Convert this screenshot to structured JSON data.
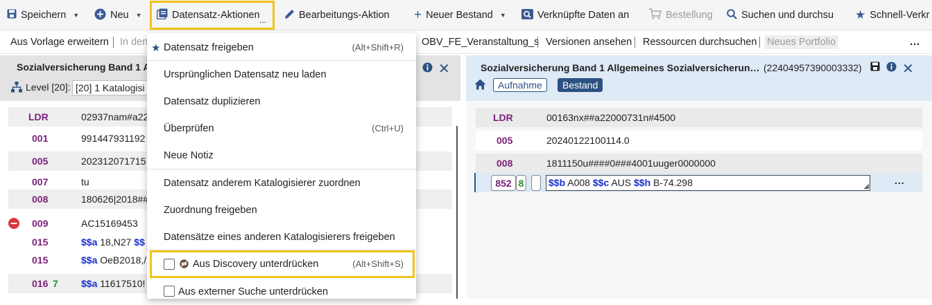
{
  "toolbar": {
    "save": "Speichern",
    "new": "Neu",
    "record_actions": "Datensatz-Aktionen",
    "record_actions_more": "...",
    "edit_actions": "Bearbeitungs-Aktion",
    "new_holding": "Neuer Bestand",
    "linked_data": "Verknüpfte Daten an",
    "order": "Bestellung",
    "search": "Suchen und durchsu",
    "quick_access": "Schnell-Verkr"
  },
  "row2": {
    "extend_template": "Aus Vorlage erweitern",
    "in_den": "In den",
    "obv": "OBV_FE_Veranstaltung_s",
    "versions": "Versionen ansehen",
    "resources": "Ressourcen durchsuchen",
    "new_portfolio": "Neues Portfolio",
    "more": "..."
  },
  "left_pane": {
    "title": "Sozialversicherung Band 1 Al",
    "level_label": "Level [20]:",
    "level_value": "[20] 1 Katalogisi",
    "rows": [
      {
        "tag": "LDR",
        "ind": "",
        "content": "02937nam#a22"
      },
      {
        "tag": "001",
        "ind": "",
        "content": "991447931192"
      },
      {
        "tag": "005",
        "ind": "",
        "content": "202312071715"
      },
      {
        "tag": "007",
        "ind": "",
        "content": "tu"
      },
      {
        "tag": "008",
        "ind": "",
        "content": "180626|2018##"
      },
      {
        "tag": "009",
        "ind": "",
        "content": "AC15169453"
      },
      {
        "tag": "015",
        "ind": "",
        "sf": "$$a",
        "content": "18,N27",
        "sf2": "$$"
      },
      {
        "tag": "015",
        "ind": "",
        "sf": "$$a",
        "content": "OeB2018,/"
      },
      {
        "tag": "016",
        "ind": "7",
        "sf": "$$a",
        "content": "11617510!"
      }
    ]
  },
  "right_pane": {
    "title": "Sozialversicherung Band 1 Allgemeines Sozialversicherun…",
    "record_id": "(22404957390003332)",
    "tab_record": "Aufnahme",
    "tab_holding": "Bestand",
    "rows": [
      {
        "tag": "LDR",
        "content": "00163nx##a22000731n#4500"
      },
      {
        "tag": "005",
        "content": "20240122100114.0"
      },
      {
        "tag": "008",
        "content": "1811150u####0###4001uuger0000000"
      }
    ],
    "edit_row": {
      "tag": "852",
      "ind1": "8",
      "ind2": "",
      "sf_b": "$$b",
      "val_b": "A008",
      "sf_c": "$$c",
      "val_c": "AUS",
      "sf_h": "$$h",
      "val_h": "B-74.298",
      "more": "..."
    }
  },
  "menu": {
    "items": [
      {
        "label": "Datensatz freigeben",
        "shortcut": "(Alt+Shift+R)"
      },
      {
        "label": "Ursprünglichen Datensatz neu laden",
        "shortcut": ""
      },
      {
        "label": "Datensatz duplizieren",
        "shortcut": ""
      },
      {
        "label": "Überprüfen",
        "shortcut": "(Ctrl+U)"
      },
      {
        "label": "Neue Notiz",
        "shortcut": ""
      },
      {
        "label": "Datensatz anderem Katalogisierer zuordnen",
        "shortcut": ""
      },
      {
        "label": "Zuordnung freigeben",
        "shortcut": ""
      },
      {
        "label": "Datensätze eines anderen Katalogisierers freigeben",
        "shortcut": ""
      },
      {
        "label": "Aus Discovery unterdrücken",
        "shortcut": "(Alt+Shift+S)"
      },
      {
        "label": "Aus externer Suche unterdrücken",
        "shortcut": ""
      }
    ]
  },
  "colors": {
    "highlight": "#f2c318",
    "brand_blue": "#2c5283",
    "tag_purple": "#7a1f7a",
    "subfield_blue": "#1a2fd0"
  }
}
